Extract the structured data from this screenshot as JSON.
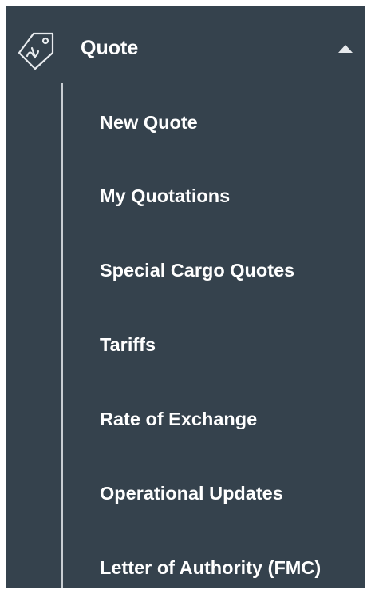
{
  "menu": {
    "title": "Quote",
    "icon": "price-tag-icon",
    "expanded_indicator_icon": "caret-up-icon",
    "items": [
      {
        "label": "New Quote"
      },
      {
        "label": "My Quotations"
      },
      {
        "label": "Special Cargo Quotes"
      },
      {
        "label": "Tariffs"
      },
      {
        "label": "Rate of Exchange"
      },
      {
        "label": "Operational Updates"
      },
      {
        "label": "Letter of Authority (FMC)"
      }
    ]
  },
  "colors": {
    "panel_background": "#35424d",
    "text": "#ffffff",
    "tree_line": "#c9ced3"
  }
}
